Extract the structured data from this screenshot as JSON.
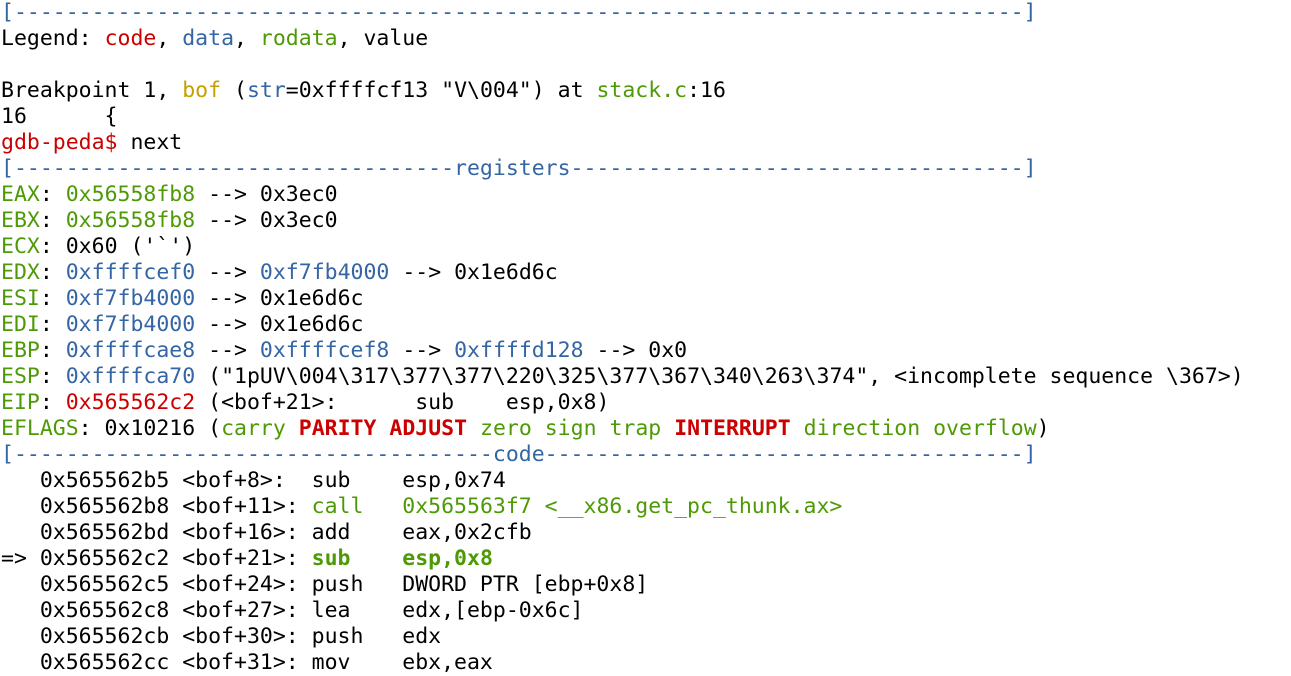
{
  "colors": {
    "red": "#cc0000",
    "blue": "#3465a4",
    "green": "#4e9a06",
    "yellow": "#c4a000",
    "text": "#000000",
    "background": "#ffffff"
  },
  "lines": [
    [
      {
        "t": "[------------------------------------------------------------------------------]",
        "c": "sep"
      }
    ],
    [
      {
        "t": "Legend: "
      },
      {
        "t": "code",
        "c": "red"
      },
      {
        "t": ", "
      },
      {
        "t": "data",
        "c": "blue"
      },
      {
        "t": ", "
      },
      {
        "t": "rodata",
        "c": "green"
      },
      {
        "t": ", value"
      }
    ],
    [],
    [
      {
        "t": "Breakpoint 1, "
      },
      {
        "t": "bof",
        "c": "yellow"
      },
      {
        "t": " ("
      },
      {
        "t": "str",
        "c": "blue"
      },
      {
        "t": "=0xffffcf13 \"V\\004\") at "
      },
      {
        "t": "stack.c",
        "c": "green"
      },
      {
        "t": ":16"
      }
    ],
    [
      {
        "t": "16\t{"
      }
    ],
    [
      {
        "t": "gdb-peda$ ",
        "c": "red"
      },
      {
        "t": "next"
      }
    ],
    [
      {
        "t": "[----------------------------------",
        "c": "sep"
      },
      {
        "t": "registers",
        "c": "sep-title"
      },
      {
        "t": "-----------------------------------]",
        "c": "sep"
      }
    ],
    [
      {
        "t": "EAX",
        "c": "green"
      },
      {
        "t": ": "
      },
      {
        "t": "0x56558fb8",
        "c": "green"
      },
      {
        "t": " --> 0x3ec0"
      }
    ],
    [
      {
        "t": "EBX",
        "c": "green"
      },
      {
        "t": ": "
      },
      {
        "t": "0x56558fb8",
        "c": "green"
      },
      {
        "t": " --> 0x3ec0"
      }
    ],
    [
      {
        "t": "ECX",
        "c": "green"
      },
      {
        "t": ": 0x60 ('`')"
      }
    ],
    [
      {
        "t": "EDX",
        "c": "green"
      },
      {
        "t": ": "
      },
      {
        "t": "0xffffcef0",
        "c": "blue"
      },
      {
        "t": " --> "
      },
      {
        "t": "0xf7fb4000",
        "c": "blue"
      },
      {
        "t": " --> 0x1e6d6c"
      }
    ],
    [
      {
        "t": "ESI",
        "c": "green"
      },
      {
        "t": ": "
      },
      {
        "t": "0xf7fb4000",
        "c": "blue"
      },
      {
        "t": " --> 0x1e6d6c"
      }
    ],
    [
      {
        "t": "EDI",
        "c": "green"
      },
      {
        "t": ": "
      },
      {
        "t": "0xf7fb4000",
        "c": "blue"
      },
      {
        "t": " --> 0x1e6d6c"
      }
    ],
    [
      {
        "t": "EBP",
        "c": "green"
      },
      {
        "t": ": "
      },
      {
        "t": "0xffffcae8",
        "c": "blue"
      },
      {
        "t": " --> "
      },
      {
        "t": "0xffffcef8",
        "c": "blue"
      },
      {
        "t": " --> "
      },
      {
        "t": "0xffffd128",
        "c": "blue"
      },
      {
        "t": " --> 0x0"
      }
    ],
    [
      {
        "t": "ESP",
        "c": "green"
      },
      {
        "t": ": "
      },
      {
        "t": "0xffffca70",
        "c": "blue"
      },
      {
        "t": " (\"1pUV\\004\\317\\377\\377\\220\\325\\377\\367\\340\\263\\374\", <incomplete sequence \\367>)"
      }
    ],
    [
      {
        "t": "EIP",
        "c": "green"
      },
      {
        "t": ": "
      },
      {
        "t": "0x565562c2",
        "c": "red"
      },
      {
        "t": " (<bof+21>:\tsub    esp,0x8)"
      }
    ],
    [
      {
        "t": "EFLAGS",
        "c": "green"
      },
      {
        "t": ": 0x10216 ("
      },
      {
        "t": "carry",
        "c": "green"
      },
      {
        "t": " "
      },
      {
        "t": "PARITY",
        "c": "red bold"
      },
      {
        "t": " "
      },
      {
        "t": "ADJUST",
        "c": "red bold"
      },
      {
        "t": " "
      },
      {
        "t": "zero",
        "c": "green"
      },
      {
        "t": " "
      },
      {
        "t": "sign",
        "c": "green"
      },
      {
        "t": " "
      },
      {
        "t": "trap",
        "c": "green"
      },
      {
        "t": " "
      },
      {
        "t": "INTERRUPT",
        "c": "red bold"
      },
      {
        "t": " "
      },
      {
        "t": "direction",
        "c": "green"
      },
      {
        "t": " "
      },
      {
        "t": "overflow",
        "c": "green"
      },
      {
        "t": ")"
      }
    ],
    [
      {
        "t": "[-------------------------------------",
        "c": "sep"
      },
      {
        "t": "code",
        "c": "sep-title"
      },
      {
        "t": "-------------------------------------]",
        "c": "sep"
      }
    ],
    [
      {
        "t": "   0x565562b5 <bof+8>:  sub    esp,0x74"
      }
    ],
    [
      {
        "t": "   0x565562b8 <bof+11>: "
      },
      {
        "t": "call   0x565563f7 <__x86.get_pc_thunk.ax>",
        "c": "green"
      }
    ],
    [
      {
        "t": "   0x565562bd <bof+16>: add    eax,0x2cfb"
      }
    ],
    [
      {
        "t": "=> 0x565562c2 <bof+21>: "
      },
      {
        "t": "sub    esp,0x8",
        "c": "green bold"
      }
    ],
    [
      {
        "t": "   0x565562c5 <bof+24>: push   DWORD PTR [ebp+0x8]"
      }
    ],
    [
      {
        "t": "   0x565562c8 <bof+27>: lea    edx,[ebp-0x6c]"
      }
    ],
    [
      {
        "t": "   0x565562cb <bof+30>: push   edx"
      }
    ],
    [
      {
        "t": "   0x565562cc <bof+31>: mov    ebx,eax"
      }
    ]
  ],
  "line_names": [
    "separator-top",
    "legend-line",
    "blank-line",
    "breakpoint-line",
    "source-line",
    "gdb-prompt-line",
    "registers-header",
    "register-eax",
    "register-ebx",
    "register-ecx",
    "register-edx",
    "register-esi",
    "register-edi",
    "register-ebp",
    "register-esp",
    "register-eip",
    "register-eflags",
    "code-header",
    "code-line",
    "code-line",
    "code-line",
    "code-line-current",
    "code-line",
    "code-line",
    "code-line",
    "code-line"
  ]
}
